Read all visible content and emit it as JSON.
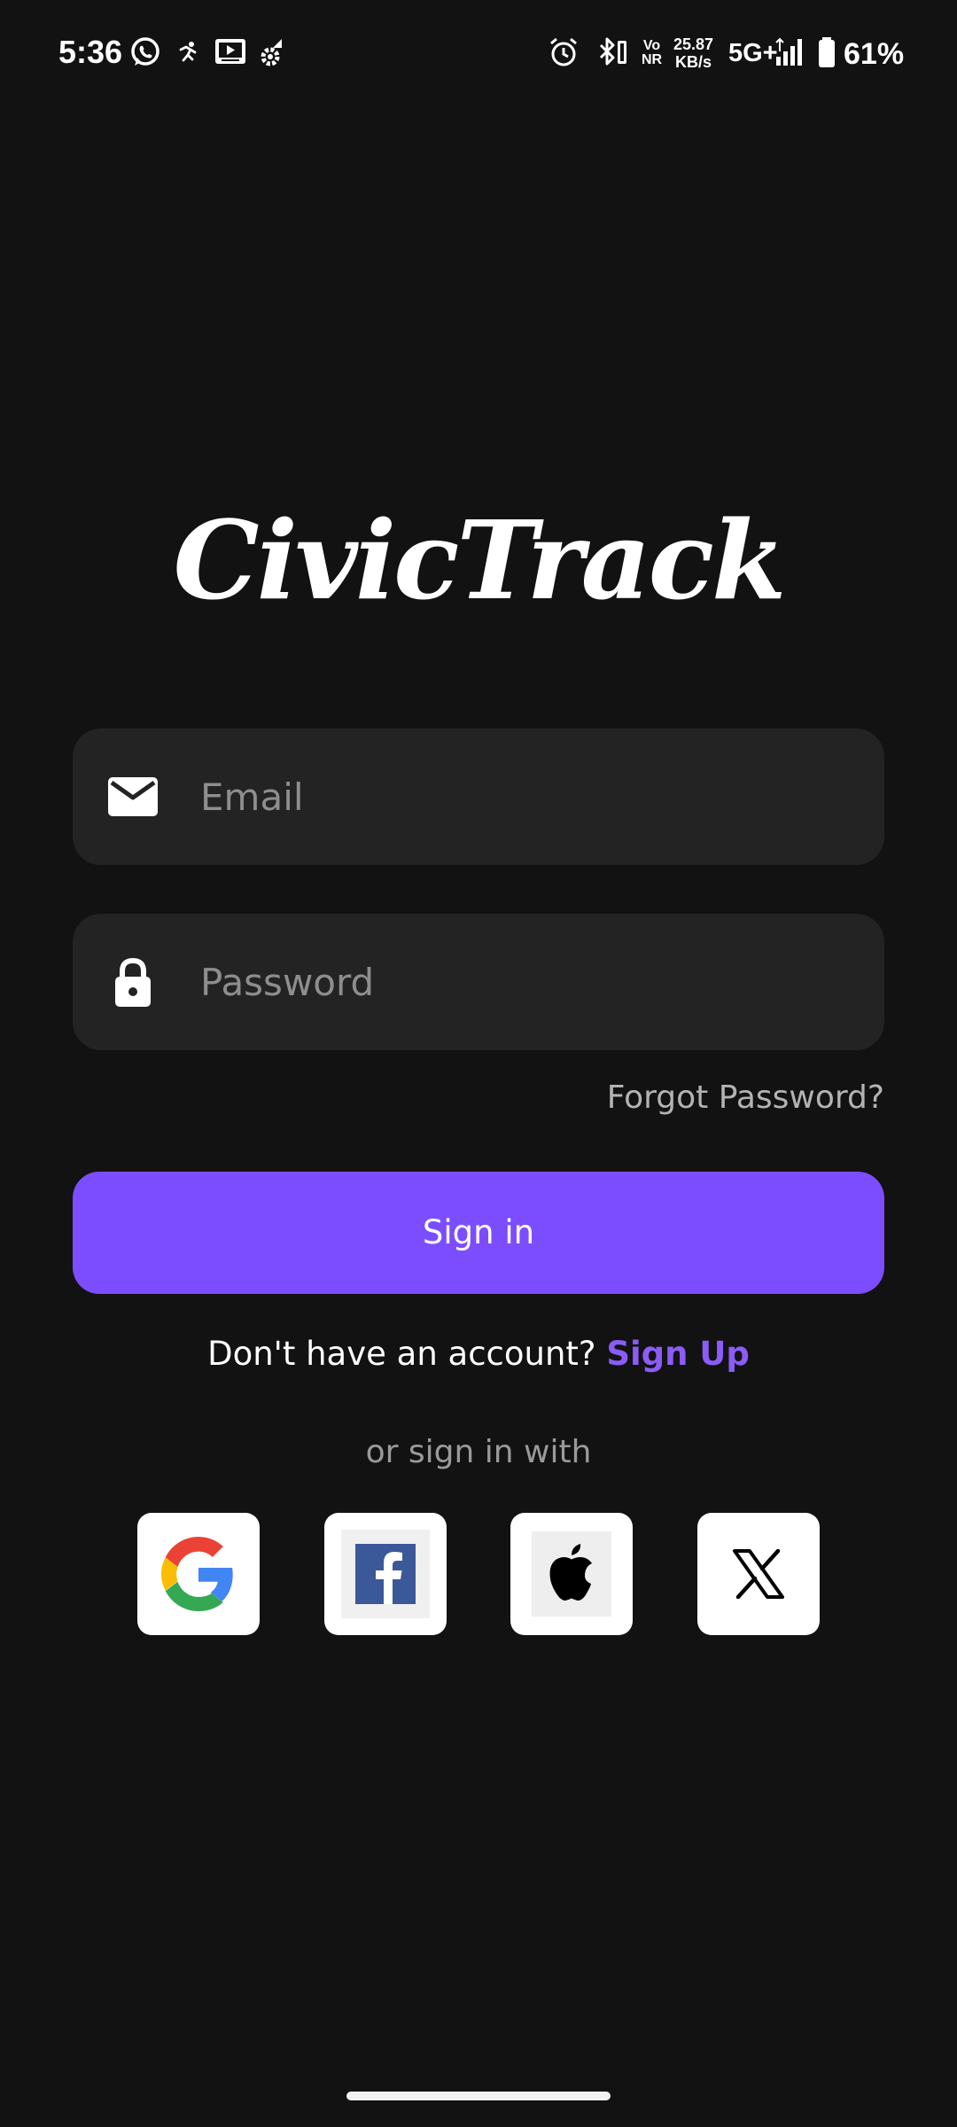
{
  "status_bar": {
    "time": "5:36",
    "net_speed_value": "25.87",
    "net_speed_unit": "KB/s",
    "network_type": "5G+",
    "volte_top": "Vo",
    "volte_bottom": "NR",
    "battery": "61%",
    "icons": [
      "whatsapp-icon",
      "running-icon",
      "media-icon",
      "network-gear-icon",
      "alarm-icon",
      "bluetooth-icon",
      "signal-icon",
      "battery-icon"
    ]
  },
  "app": {
    "logo": "CivicTrack"
  },
  "form": {
    "email_placeholder": "Email",
    "password_placeholder": "Password",
    "forgot_password": "Forgot Password?",
    "signin_label": "Sign in"
  },
  "signup": {
    "prompt": "Don't have an account?",
    "link": "Sign Up"
  },
  "social": {
    "label": "or sign in with",
    "providers": [
      "google-icon",
      "facebook-icon",
      "apple-icon",
      "x-icon"
    ]
  },
  "colors": {
    "background": "#121212",
    "field": "#232323",
    "accent": "#7c4dff",
    "link": "#8b5cf6"
  }
}
